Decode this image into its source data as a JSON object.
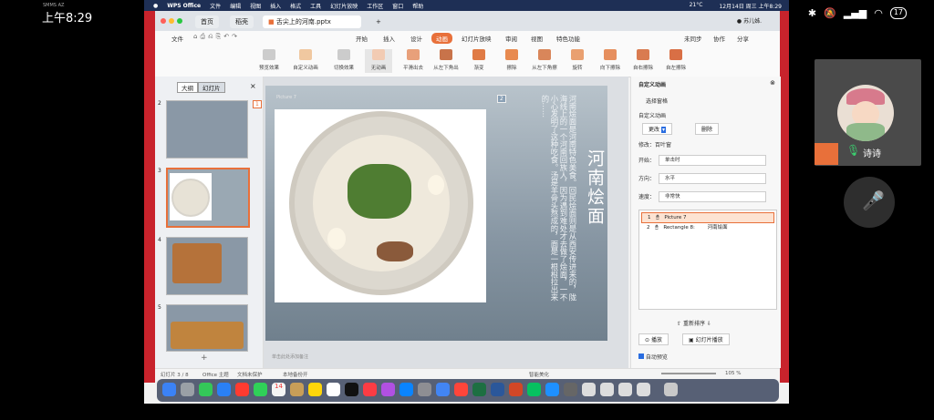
{
  "phone_status": {
    "carrier_small": "SMMS AZ",
    "time": "上午8:29",
    "battery": "17"
  },
  "mac_menubar": {
    "app": "WPS Office",
    "menus": [
      "文件",
      "编辑",
      "视图",
      "插入",
      "格式",
      "工具",
      "幻灯片放映",
      "工作区",
      "窗口",
      "帮助"
    ],
    "right": [
      "21°C",
      "12月14日 周三 上午8:29"
    ]
  },
  "tabs": {
    "home": "首页",
    "shell": "稻壳",
    "doc": "舌尖上的河南.pptx",
    "new_tab": "+"
  },
  "ribbon_tabs": [
    "文件",
    "开始",
    "插入",
    "设计",
    "动画",
    "幻灯片放映",
    "审阅",
    "视图",
    "特色功能"
  ],
  "ribbon_tabs_active": "动画",
  "ribbon_right": [
    "未同步",
    "协作",
    "分享"
  ],
  "ribbon_buttons": [
    "预览效果",
    "自定义动画",
    "切换效果",
    "无动画",
    "平滑出去",
    "从左下角出",
    "渐变",
    "擦除",
    "从左下角擦",
    "旋转",
    "向下擦除",
    "自右擦除",
    "自左擦除"
  ],
  "left_pane": {
    "tab_outline": "大纲",
    "tab_slides": "幻灯片",
    "slide_numbers": [
      "2",
      "3",
      "4",
      "5"
    ],
    "add": "+"
  },
  "slide": {
    "number_badge": "1",
    "title_vertical": "河南烩面",
    "body_vertical": "河南烩面是河南特色美食。回民烩面则是从西安传进来的，陇海线上的一个河南回族人，因为遇到难处才去做了烩面，一不小心发明了这种吃食。汤是羊骨头熬成的，面是一根根拉出来的……",
    "marker": "2",
    "placeholder": "Picture 7"
  },
  "right_pane": {
    "title": "自定义动画",
    "select_pane": "选择窗格",
    "section_custom": "自定义动画",
    "change_btn": "更改",
    "delete_btn": "删除",
    "modify_label": "修改：百叶窗",
    "start_label": "开始：",
    "start_value": "单击时",
    "dir_label": "方向：",
    "dir_value": "水平",
    "speed_label": "速度：",
    "speed_value": "非常快",
    "items": [
      {
        "n": "1",
        "name": "Picture 7"
      },
      {
        "n": "2",
        "name": "Rectangle 8:",
        "extra": "河南烩面"
      }
    ],
    "reorder": "重新排序",
    "play_btn": "播放",
    "slideshow_btn": "幻灯片播放",
    "autopreview": "自动预览"
  },
  "statusbar": {
    "slide_info": "幻灯片 3 / 8",
    "theme": "Office 主题",
    "doc_check": "文档未保护",
    "recover": "本地备份开",
    "notes": "单击此处添加备注",
    "beautify": "智能美化",
    "zoom": "105 %"
  },
  "meeting": {
    "name": "诗诗"
  },
  "colors": {
    "accent": "#e8703a",
    "menubar": "#1e2f55",
    "video_tile": "#4a4a4a"
  }
}
